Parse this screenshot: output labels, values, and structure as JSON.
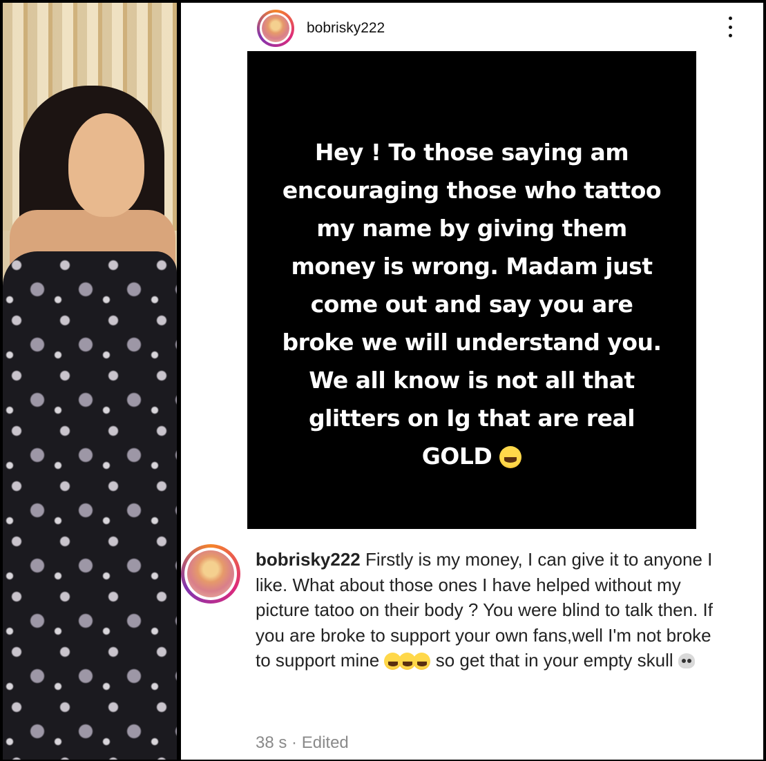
{
  "post": {
    "username": "bobrisky222",
    "story_text": "Hey ! To those saying am encouraging those who tattoo my name by giving them money is wrong. Madam just come out and say you are broke we will understand you. We all know is not all that glitters on Ig that are real GOLD",
    "story_emoji": "face-with-tears-of-joy-icon"
  },
  "comment": {
    "username": "bobrisky222",
    "text_part1": "Firstly is my money, I can give it to anyone I like. What about those ones I have helped without my picture tatoo on their body ? You were blind to talk then. If you are broke to support your own fans,well I'm not broke to support mine",
    "text_part2": "so get that in your empty skull",
    "time": "38 s",
    "separator": "·",
    "edited": "Edited"
  },
  "colors": {
    "story_bg": "#000000",
    "card_bg": "#ffffff",
    "avatar_ring": "#dd2a7b",
    "meta_text": "#8a8a8a"
  }
}
